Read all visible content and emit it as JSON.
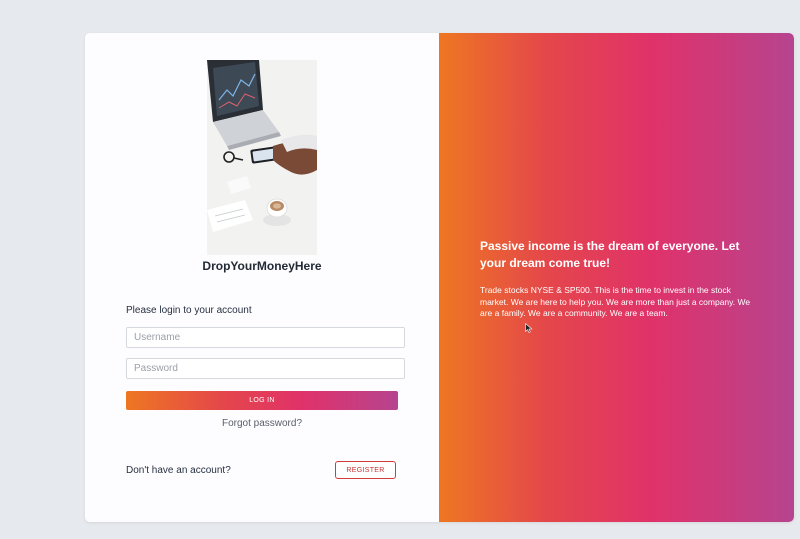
{
  "brand": {
    "name": "DropYourMoneyHere"
  },
  "login": {
    "prompt": "Please login to your account",
    "username_placeholder": "Username",
    "password_placeholder": "Password",
    "login_button": "LOG IN",
    "forgot_link": "Forgot password?"
  },
  "register": {
    "prompt": "Don't have an account?",
    "button": "REGISTER"
  },
  "promo": {
    "headline": "Passive income is the dream of everyone. Let your dream come true!",
    "body": "Trade stocks NYSE & SP500. This is the time to invest in the stock market. We are here to help you. We are more than just a company. We are a family. We are a community. We are a team."
  },
  "colors": {
    "gradient_start": "#ee7722",
    "gradient_mid": "#e0326a",
    "gradient_end": "#b6448f",
    "register_border": "#d13b3b"
  },
  "icons": {
    "hero_image": "laptop-and-phone-photo",
    "cursor": "mouse-pointer-icon"
  }
}
